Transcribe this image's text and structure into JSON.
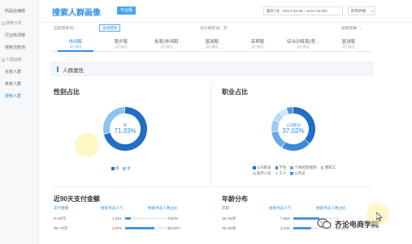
{
  "sidebar": {
    "items": [
      {
        "label": "商品店铺榜",
        "type": "item"
      },
      {
        "label": "搜索分析",
        "type": "group"
      },
      {
        "label": "行业热词榜",
        "type": "item"
      },
      {
        "label": "搜索词查询",
        "type": "item"
      },
      {
        "label": "人群画像",
        "type": "group"
      },
      {
        "label": "买家人群",
        "type": "item"
      },
      {
        "label": "卖家人群",
        "type": "item"
      },
      {
        "label": "搜索人群",
        "type": "active"
      }
    ]
  },
  "header": {
    "title": "搜索人群画像",
    "tag": "平台版",
    "date_range": "最近7天（2017-02-08 ~ 2017-02-08）",
    "channel": "所有终端",
    "channel_caret": "▾"
  },
  "filter": {
    "label": "当前搜索词：",
    "chip": "运动鞋男",
    "compare_label": "对比搜索词：无",
    "fill_rate": "搜索结果",
    "fill_caret": "⌄"
  },
  "tabs": [
    {
      "label": "休闲鞋",
      "sub": "运行商品"
    },
    {
      "label": "跑步鞋",
      "sub": "运行商品"
    },
    {
      "label": "板鞋/休闲鞋",
      "sub": "运行商品"
    },
    {
      "label": "篮球鞋",
      "sub": "运行商品"
    },
    {
      "label": "高帮鞋",
      "sub": "运行商品"
    },
    {
      "label": "综合训练鞋/室...",
      "sub": "运行商品"
    },
    {
      "label": "篮球鞋",
      "sub": "运行商品"
    }
  ],
  "active_tab_index": 0,
  "section": {
    "title": "人群属性"
  },
  "gender": {
    "title": "性别占比",
    "center_label": "男",
    "center_value": "71.33%",
    "legend": [
      {
        "name": "男",
        "color": "#1f6fc4"
      },
      {
        "name": "女",
        "color": "#8cc4ee"
      }
    ],
    "values": [
      71.33,
      28.67
    ]
  },
  "occupation": {
    "title": "职业占比",
    "center_label": "公司职员",
    "center_value": "37.02%",
    "legend": [
      {
        "name": "公司职员",
        "color": "#1f6fc4"
      },
      {
        "name": "学生",
        "color": "#3b8ad8"
      },
      {
        "name": "个体经营/服务",
        "color": "#6aa9e6"
      },
      {
        "name": "教职工",
        "color": "#9ccaf0"
      },
      {
        "name": "医务人员",
        "color": "#b9d9f5"
      },
      {
        "name": "工人",
        "color": "#d2e6f8"
      },
      {
        "name": "公务员",
        "color": "#5595d8"
      }
    ],
    "values": [
      37.02,
      22,
      14,
      9,
      7,
      6,
      5
    ]
  },
  "payment": {
    "title": "近90天支付金额",
    "columns": [
      "支付金额",
      "搜索点击人气",
      "搜索点击人数占比"
    ],
    "rows": [
      {
        "range": "0~35元",
        "popularity": "1,251",
        "share": "7.33%",
        "fill": 0.12
      },
      {
        "range": "35~75元",
        "popularity": "3,875",
        "share": "42.62%",
        "fill": 0.62
      }
    ]
  },
  "age": {
    "title": "年龄分布",
    "columns": [
      "年龄",
      "搜索点击人气",
      "搜索点击人数占比"
    ],
    "rows": [
      {
        "range": "18~25岁",
        "popularity": "7,853",
        "share": "...",
        "fill": 0.55
      },
      {
        "range": "26~30岁",
        "popularity": "4,233",
        "share": "26.45%",
        "fill": 0.38
      }
    ]
  },
  "watermark": {
    "text": "齐论电商学院"
  }
}
